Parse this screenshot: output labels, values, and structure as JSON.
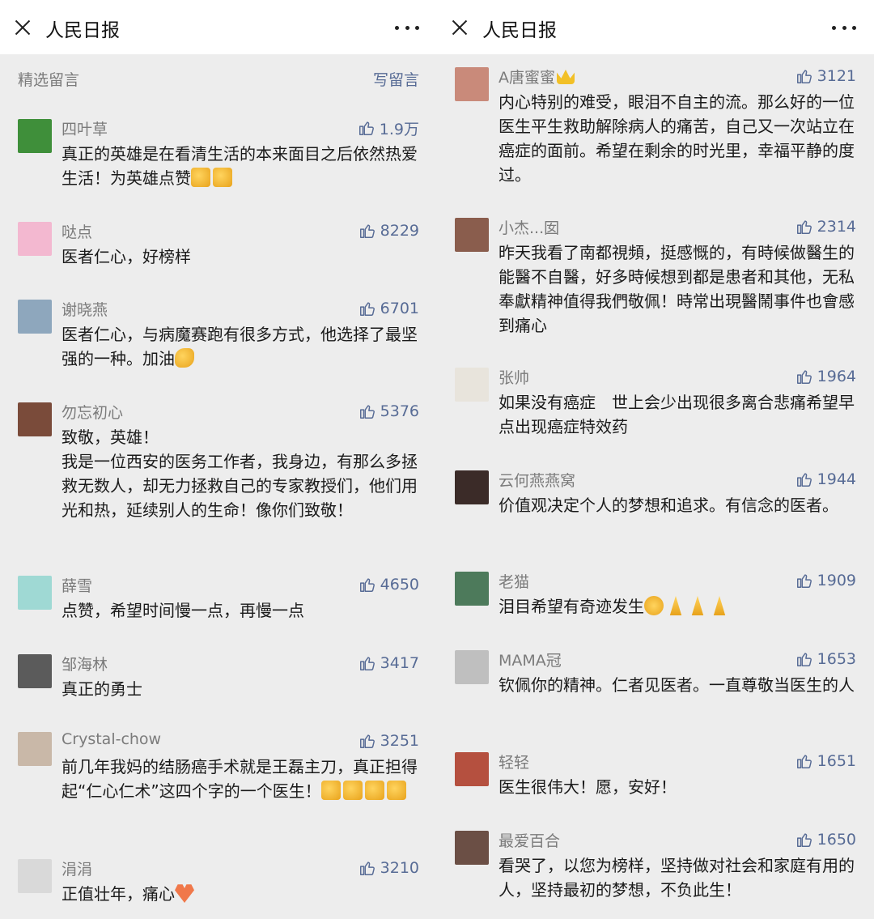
{
  "left_panel": {
    "title": "人民日报",
    "section_label": "精选留言",
    "write_label": "写留言",
    "comments": [
      {
        "nickname": "四叶草",
        "likes": "1.9万",
        "text": "真正的英雄是在看清生活的本来面目之后依然热爱生活！为英雄点赞",
        "emojis": [
          "thumbs-up",
          "thumbs-up"
        ],
        "avatar_color": "#3f8f3a"
      },
      {
        "nickname": "哒点",
        "likes": "8229",
        "text": "医者仁心，好榜样",
        "avatar_color": "#f3b8d0"
      },
      {
        "nickname": "谢晓燕",
        "likes": "6701",
        "text": "医者仁心，与病魔赛跑有很多方式，他选择了最坚强的一种。加油",
        "emojis": [
          "flexed-biceps"
        ],
        "avatar_color": "#8ea7bd"
      },
      {
        "nickname": "勿忘初心",
        "likes": "5376",
        "text": "致敬，英雄！\n我是一位西安的医务工作者，我身边，有那么多拯救无数人，却无力拯救自己的专家教授们，他们用光和热，延续别人的生命！像你们致敬！",
        "avatar_color": "#7a4b3a"
      },
      {
        "nickname": "薛雪",
        "likes": "4650",
        "text": "点赞，希望时间慢一点，再慢一点",
        "avatar_color": "#9fd9d4"
      },
      {
        "nickname": "邹海林",
        "likes": "3417",
        "text": "真正的勇士",
        "avatar_color": "#5b5b5b"
      },
      {
        "nickname": "Crystal-chow",
        "likes": "3251",
        "text": "前几年我妈的结肠癌手术就是王磊主刀，真正担得起“仁心仁术”这四个字的一个医生！",
        "emojis": [
          "thumbs-up",
          "thumbs-up",
          "thumbs-up",
          "thumbs-up"
        ],
        "avatar_color": "#c9b8a8"
      },
      {
        "nickname": "涓涓",
        "likes": "3210",
        "text": "正值壮年，痛心",
        "emojis": [
          "broken-heart"
        ],
        "avatar_color": "#d9d9d9"
      }
    ]
  },
  "right_panel": {
    "title": "人民日报",
    "comments": [
      {
        "nickname": "A唐蜜蜜",
        "nickname_emoji": "crown",
        "likes": "3121",
        "text": "内心特别的难受，眼泪不自主的流。那么好的一位医生平生救助解除病人的痛苦，自己又一次站立在癌症的面前。希望在剩余的时光里，幸福平静的度过。",
        "avatar_color": "#c98a7a"
      },
      {
        "nickname": "小杰...囡",
        "likes": "2314",
        "text": "昨天我看了南都視頻，挺感慨的，有時候做醫生的能醫不自醫，好多時候想到都是患者和其他，无私奉獻精神值得我們敬佩！時常出現醫鬧事件也會感到痛心",
        "avatar_color": "#8a5d4d"
      },
      {
        "nickname": "张帅",
        "likes": "1964",
        "text": "如果没有癌症　世上会少出现很多离合悲痛希望早点出现癌症特效药",
        "avatar_color": "#e8e4dc"
      },
      {
        "nickname": "云何燕燕窝",
        "likes": "1944",
        "text": "价值观决定个人的梦想和追求。有信念的医者。",
        "avatar_color": "#3b2b28"
      },
      {
        "nickname": "老猫",
        "likes": "1909",
        "text": "泪目希望有奇迹发生",
        "emojis": [
          "crying-face",
          "pray",
          "pray",
          "pray"
        ],
        "avatar_color": "#4d7a5b"
      },
      {
        "nickname": "MAMA冠",
        "likes": "1653",
        "text": "钦佩你的精神。仁者见医者。一直尊敬当医生的人",
        "avatar_color": "#bfbfbf"
      },
      {
        "nickname": "轻轻",
        "likes": "1651",
        "text": "医生很伟大！愿，安好！",
        "avatar_color": "#b5503f"
      },
      {
        "nickname": "最爱百合",
        "likes": "1650",
        "text": "看哭了，以您为榜样，坚持做对社会和家庭有用的人，坚持最初的梦想，不负此生！",
        "avatar_color": "#6b4f45"
      }
    ]
  }
}
